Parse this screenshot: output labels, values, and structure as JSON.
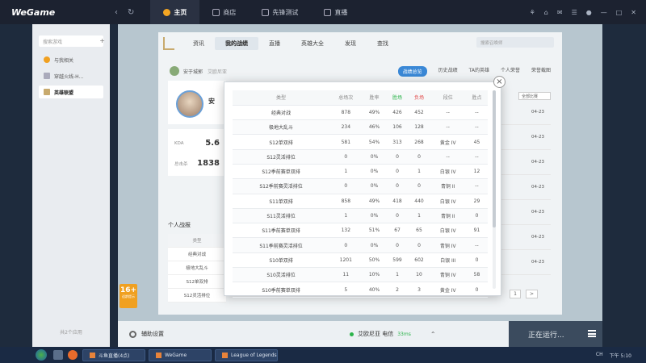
{
  "topbar": {
    "app_name": "WeGame",
    "back_glyph": "‹",
    "refresh_glyph": "↻",
    "tabs": [
      {
        "label": "主页",
        "icon": "home-icon"
      },
      {
        "label": "商店",
        "icon": "shop-icon"
      },
      {
        "label": "先锋测试",
        "icon": "test-icon"
      },
      {
        "label": "直播",
        "icon": "live-icon"
      }
    ],
    "right_glyphs": [
      "⚘",
      "⌂",
      "✉",
      "☰",
      "●",
      "—",
      "□",
      "✕"
    ]
  },
  "sidebar": {
    "search_placeholder": "搜索游戏",
    "add_glyph": "+",
    "items": [
      {
        "label": "与我相关"
      },
      {
        "label": "穿越火线-H..."
      },
      {
        "label": "英雄联盟"
      }
    ],
    "footer": "共2个应用"
  },
  "client": {
    "nav": [
      "资讯",
      "我的战绩",
      "直播",
      "英雄大全",
      "发现",
      "查找"
    ],
    "search_placeholder": "搜索召唤师",
    "player_name": "安于城郭",
    "player_tag": "艾欧尼亚",
    "sub_tabs": [
      "战绩总览",
      "历史战绩",
      "TA的英雄",
      "个人荣誉",
      "荣誉截图"
    ],
    "hero_initial": "安",
    "kda_label": "KDA",
    "kda_value": "5.6",
    "score_label": "总击杀",
    "score_value": "1838",
    "personal_title": "个人战报",
    "personal_rows": [
      "类型",
      "经典对战",
      "极地大乱斗",
      "S12单双排",
      "S12灵活排位"
    ],
    "right_select": "全部比赛",
    "right_rows": [
      "04-23",
      "04-23",
      "04-23",
      "04-23",
      "04-23",
      "04-23",
      "04-23"
    ],
    "pager": [
      "1",
      ">"
    ]
  },
  "age_rating": {
    "number": "16+",
    "label": "适龄提示"
  },
  "bottombar": {
    "settings_label": "辅助设置",
    "game_name": "艾欧尼亚 电信",
    "ping": "33ms",
    "chevron": "⌃",
    "running_label": "正在运行..."
  },
  "modal": {
    "close_glyph": "×",
    "headers": [
      "类型",
      "总场次",
      "胜率",
      "胜场",
      "负场",
      "段位",
      "胜点"
    ],
    "rows": [
      [
        "经典对战",
        "878",
        "49%",
        "426",
        "452",
        "--",
        "--"
      ],
      [
        "极地大乱斗",
        "234",
        "46%",
        "106",
        "128",
        "--",
        "--"
      ],
      [
        "S12单双排",
        "581",
        "54%",
        "313",
        "268",
        "黄金 IV",
        "45"
      ],
      [
        "S12灵活排位",
        "0",
        "0%",
        "0",
        "0",
        "--",
        "--"
      ],
      [
        "S12季前赛单双排",
        "1",
        "0%",
        "0",
        "1",
        "白银 IV",
        "12"
      ],
      [
        "S12季前赛灵活排位",
        "0",
        "0%",
        "0",
        "0",
        "青铜 II",
        "--"
      ],
      [
        "S11单双排",
        "858",
        "49%",
        "418",
        "440",
        "白银 IV",
        "29"
      ],
      [
        "S11灵活排位",
        "1",
        "0%",
        "0",
        "1",
        "青铜 II",
        "0"
      ],
      [
        "S11季前赛单双排",
        "132",
        "51%",
        "67",
        "65",
        "白银 IV",
        "91"
      ],
      [
        "S11季前赛灵活排位",
        "0",
        "0%",
        "0",
        "0",
        "青铜 IV",
        "--"
      ],
      [
        "S10单双排",
        "1201",
        "50%",
        "599",
        "602",
        "白银 III",
        "0"
      ],
      [
        "S10灵活排位",
        "11",
        "10%",
        "1",
        "10",
        "青铜 IV",
        "58"
      ],
      [
        "S10季前赛单双排",
        "5",
        "40%",
        "2",
        "3",
        "黄金 IV",
        "0"
      ]
    ]
  },
  "taskbar": {
    "tasks": [
      "斗鱼直播(4点)",
      "WeGame",
      "League of Legends"
    ],
    "tray": [
      "CH",
      "下午 5:10"
    ]
  }
}
